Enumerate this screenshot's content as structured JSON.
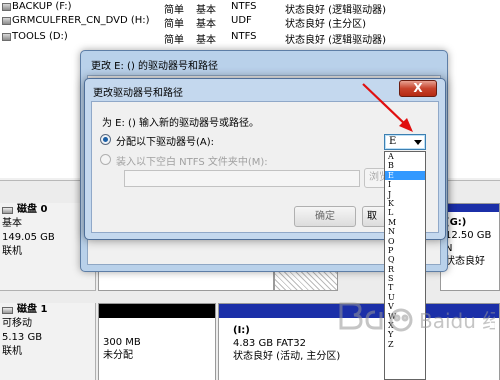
{
  "volumes": [
    {
      "name": "BACKUP (F:)",
      "type": "简单",
      "mode": "基本",
      "fs": "NTFS",
      "status": "状态良好 (逻辑驱动器)"
    },
    {
      "name": "GRMCULFRER_CN_DVD (H:)",
      "type": "简单",
      "mode": "基本",
      "fs": "UDF",
      "status": "状态良好 (主分区)"
    },
    {
      "name": "TOOLS (D:)",
      "type": "简单",
      "mode": "基本",
      "fs": "NTFS",
      "status": "状态良好 (逻辑驱动器)"
    }
  ],
  "outer_dialog": {
    "title": "更改 E: () 的驱动器号和路径"
  },
  "inner_dialog": {
    "title": "更改驱动器号和路径",
    "close_label": "X",
    "prompt": "为 E: () 输入新的驱动器号或路径。",
    "option_assign": "分配以下驱动器号(A):",
    "option_mount": "装入以下空白 NTFS 文件夹中(M):",
    "browse_label": "浏览(",
    "ok_label": "确定",
    "cancel_label": "取"
  },
  "drive_letter": {
    "selected": "E",
    "options": [
      "A",
      "B",
      "E",
      "I",
      "J",
      "K",
      "L",
      "M",
      "N",
      "O",
      "P",
      "Q",
      "R",
      "S",
      "T",
      "U",
      "V",
      "W",
      "X",
      "Y",
      "Z"
    ]
  },
  "disks": [
    {
      "name": "磁盘 0",
      "lines": [
        "基本",
        "149.05 GB",
        "联机"
      ]
    },
    {
      "name": "磁盘 1",
      "lines": [
        "可移动",
        "5.13 GB",
        "联机"
      ]
    }
  ],
  "partitions": {
    "g_drive": {
      "name": "(G:)",
      "size": "12.50 GB N",
      "status": "状态良好"
    },
    "unallocated": {
      "size": "300 MB",
      "status": "未分配"
    },
    "i_drive": {
      "name": "(I:)",
      "size": "4.83 GB FAT32",
      "status": "状态良好 (活动, 主分区)"
    },
    "c_drive_tail": {
      "text": "确定"
    }
  },
  "colors": {
    "primary_partition_bar": "#1b2fa8",
    "unallocated_bar": "#000000",
    "accent_blue": "#3399ff",
    "arrow": "#e01010"
  },
  "watermark": {
    "text": "Baidu 经验"
  }
}
